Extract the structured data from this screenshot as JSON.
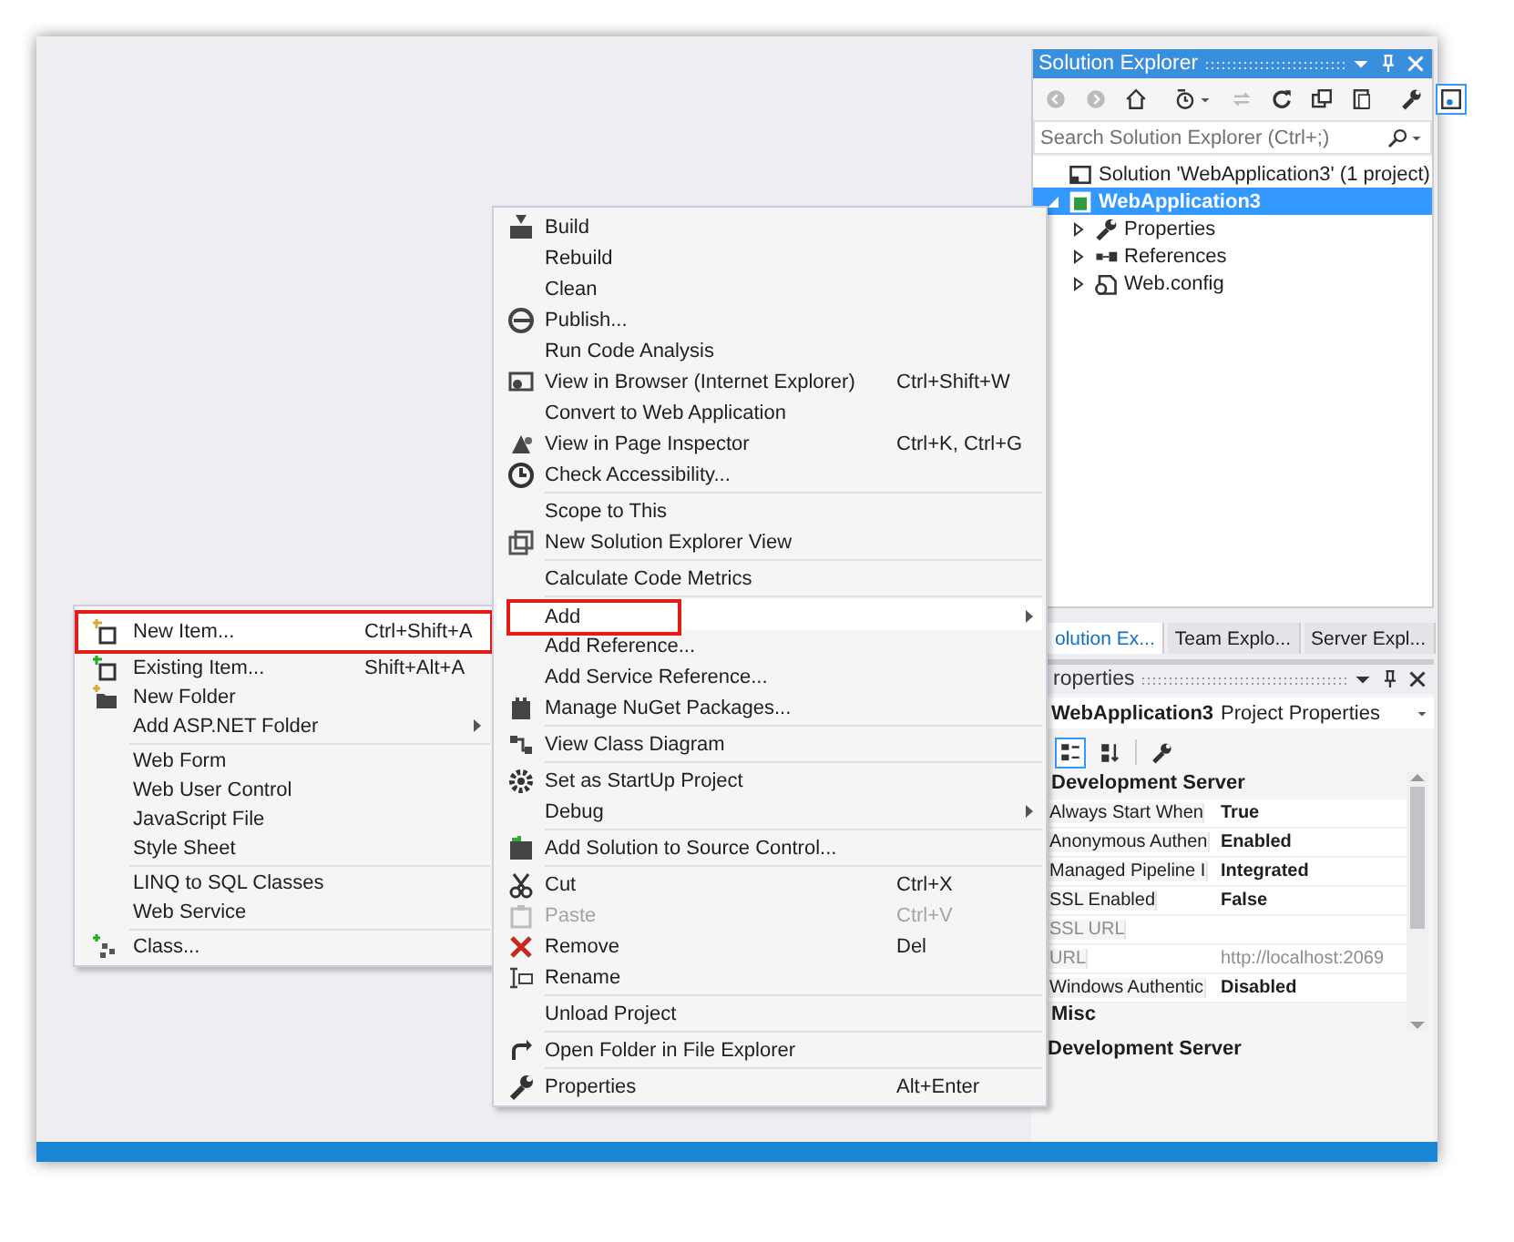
{
  "solution_explorer": {
    "title": "Solution Explorer",
    "search": {
      "placeholder": "Search Solution Explorer (Ctrl+;)"
    },
    "tree": [
      {
        "label": "Solution 'WebApplication3' (1 project)",
        "selected": false,
        "children": [
          {
            "label": "WebApplication3",
            "selected": true,
            "expanded": true,
            "children": [
              {
                "label": "Properties",
                "selected": false,
                "expanded": false
              },
              {
                "label": "References",
                "selected": false,
                "expanded": false
              },
              {
                "label": "Web.config",
                "selected": false,
                "expanded": false
              }
            ]
          }
        ]
      }
    ]
  },
  "panel_tabs": [
    {
      "label": "olution Ex...",
      "selected": true
    },
    {
      "label": "Team Explo...",
      "selected": false
    },
    {
      "label": "Server Expl...",
      "selected": false
    }
  ],
  "properties": {
    "title": "roperties",
    "object_name": "WebApplication3",
    "object_type": "Project Properties",
    "categories": [
      {
        "name": "Development Server",
        "rows": [
          {
            "name": "Always Start When",
            "value": "True",
            "readonly": false
          },
          {
            "name": "Anonymous Authen",
            "value": "Enabled",
            "readonly": false
          },
          {
            "name": "Managed Pipeline I",
            "value": "Integrated",
            "readonly": false
          },
          {
            "name": "SSL Enabled",
            "value": "False",
            "readonly": false
          },
          {
            "name": "SSL URL",
            "readonly": true
          },
          {
            "name": "URL",
            "value": "http://localhost:2069",
            "readonly": true
          },
          {
            "name": "Windows Authentic",
            "value": "Disabled",
            "readonly": false
          }
        ]
      },
      {
        "name": "Misc"
      }
    ],
    "description_title": "Development Server"
  },
  "context_menu": {
    "items": [
      {
        "kind": "item",
        "label": "Build",
        "selected": false,
        "disabled": false
      },
      {
        "kind": "item",
        "label": "Rebuild",
        "selected": false,
        "disabled": false
      },
      {
        "kind": "item",
        "label": "Clean",
        "selected": false,
        "disabled": false
      },
      {
        "kind": "item",
        "label": "Publish...",
        "selected": false,
        "disabled": false
      },
      {
        "kind": "item",
        "label": "Run Code Analysis",
        "selected": false,
        "disabled": false
      },
      {
        "kind": "item",
        "label": "View in Browser (Internet Explorer)",
        "shortcut": "Ctrl+Shift+W",
        "selected": false,
        "disabled": false
      },
      {
        "kind": "item",
        "label": "Convert to Web Application",
        "selected": false,
        "disabled": false
      },
      {
        "kind": "item",
        "label": "View in Page Inspector",
        "shortcut": "Ctrl+K, Ctrl+G",
        "selected": false,
        "disabled": false
      },
      {
        "kind": "item",
        "label": "Check Accessibility...",
        "selected": false,
        "disabled": false
      },
      {
        "kind": "separator"
      },
      {
        "kind": "item",
        "label": "Scope to This",
        "selected": false,
        "disabled": false
      },
      {
        "kind": "item",
        "label": "New Solution Explorer View",
        "selected": false,
        "disabled": false
      },
      {
        "kind": "separator"
      },
      {
        "kind": "item",
        "label": "Calculate Code Metrics",
        "selected": false,
        "disabled": false
      },
      {
        "kind": "separator"
      },
      {
        "kind": "item",
        "label": "Add",
        "submenu": true,
        "selected": true,
        "disabled": false
      },
      {
        "kind": "item",
        "label": "Add Reference...",
        "selected": false,
        "disabled": false
      },
      {
        "kind": "item",
        "label": "Add Service Reference...",
        "selected": false,
        "disabled": false
      },
      {
        "kind": "item",
        "label": "Manage NuGet Packages...",
        "selected": false,
        "disabled": false
      },
      {
        "kind": "separator"
      },
      {
        "kind": "item",
        "label": "View Class Diagram",
        "selected": false,
        "disabled": false
      },
      {
        "kind": "separator"
      },
      {
        "kind": "item",
        "label": "Set as StartUp Project",
        "selected": false,
        "disabled": false
      },
      {
        "kind": "item",
        "label": "Debug",
        "submenu": true,
        "selected": false,
        "disabled": false
      },
      {
        "kind": "separator"
      },
      {
        "kind": "item",
        "label": "Add Solution to Source Control...",
        "selected": false,
        "disabled": false
      },
      {
        "kind": "separator"
      },
      {
        "kind": "item",
        "label": "Cut",
        "shortcut": "Ctrl+X",
        "selected": false,
        "disabled": false
      },
      {
        "kind": "item",
        "label": "Paste",
        "shortcut": "Ctrl+V",
        "selected": false,
        "disabled": true
      },
      {
        "kind": "item",
        "label": "Remove",
        "shortcut": "Del",
        "selected": false,
        "disabled": false
      },
      {
        "kind": "item",
        "label": "Rename",
        "selected": false,
        "disabled": false
      },
      {
        "kind": "separator"
      },
      {
        "kind": "item",
        "label": "Unload Project",
        "selected": false,
        "disabled": false
      },
      {
        "kind": "separator"
      },
      {
        "kind": "item",
        "label": "Open Folder in File Explorer",
        "selected": false,
        "disabled": false
      },
      {
        "kind": "separator"
      },
      {
        "kind": "item",
        "label": "Properties",
        "shortcut": "Alt+Enter",
        "selected": false,
        "disabled": false
      }
    ]
  },
  "add_submenu": {
    "items": [
      {
        "kind": "item",
        "label": "New Item...",
        "shortcut": "Ctrl+Shift+A",
        "selected": true,
        "disabled": false
      },
      {
        "kind": "item",
        "label": "Existing Item...",
        "shortcut": "Shift+Alt+A",
        "selected": false,
        "disabled": false
      },
      {
        "kind": "item",
        "label": "New Folder",
        "selected": false,
        "disabled": false
      },
      {
        "kind": "item",
        "label": "Add ASP.NET Folder",
        "submenu": true,
        "selected": false,
        "disabled": false
      },
      {
        "kind": "separator"
      },
      {
        "kind": "item",
        "label": "Web Form",
        "selected": false,
        "disabled": false
      },
      {
        "kind": "item",
        "label": "Web User Control",
        "selected": false,
        "disabled": false
      },
      {
        "kind": "item",
        "label": "JavaScript File",
        "selected": false,
        "disabled": false
      },
      {
        "kind": "item",
        "label": "Style Sheet",
        "selected": false,
        "disabled": false
      },
      {
        "kind": "separator"
      },
      {
        "kind": "item",
        "label": "LINQ to SQL Classes",
        "selected": false,
        "disabled": false
      },
      {
        "kind": "item",
        "label": "Web Service",
        "selected": false,
        "disabled": false
      },
      {
        "kind": "separator"
      },
      {
        "kind": "item",
        "label": "Class...",
        "selected": false,
        "disabled": false
      }
    ]
  }
}
